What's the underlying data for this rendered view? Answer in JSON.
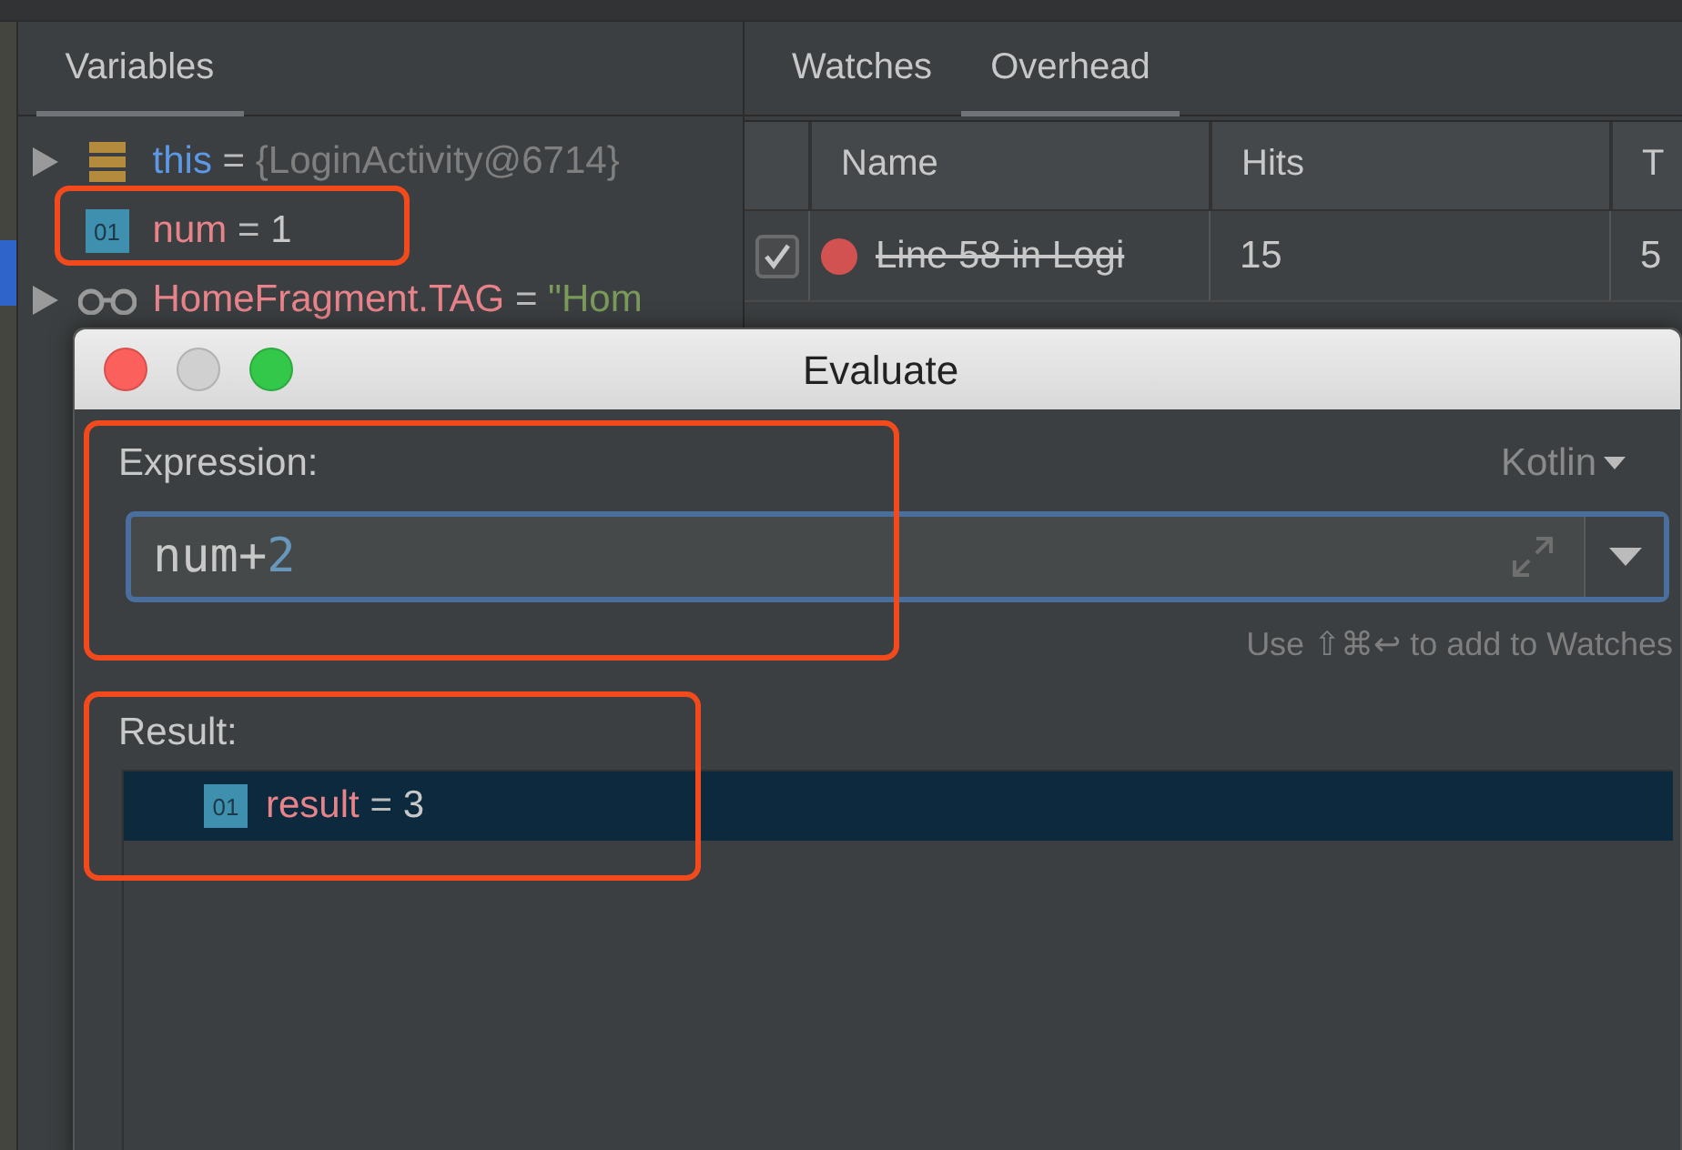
{
  "variables_panel": {
    "tab": {
      "label": "Variables",
      "selected": true
    },
    "items": [
      {
        "kind": "object",
        "expandable": true,
        "name": "this",
        "separator": "=",
        "value": "{LoginActivity@6714}"
      },
      {
        "kind": "primitive",
        "expandable": false,
        "icon_text": "01",
        "name": "num",
        "separator": "=",
        "value": "1"
      },
      {
        "kind": "static",
        "expandable": true,
        "name": "HomeFragment.TAG",
        "separator": "=",
        "value": "\"Hom"
      }
    ]
  },
  "right_panel": {
    "tabs": [
      {
        "label": "Watches",
        "selected": false
      },
      {
        "label": "Overhead",
        "selected": true
      }
    ],
    "table": {
      "columns": [
        "Name",
        "Hits",
        "T"
      ],
      "rows": [
        {
          "checked": true,
          "muted": true,
          "color": "#d25252",
          "cells": [
            "Line 58 in Logi",
            "15",
            "5"
          ]
        }
      ]
    }
  },
  "dialog": {
    "title": "Evaluate",
    "expression_label": "Expression:",
    "language": "Kotlin",
    "expression": [
      {
        "kind": "identifier",
        "text": "num+"
      },
      {
        "kind": "number",
        "text": "2"
      }
    ],
    "hint": "Use ⇧⌘↩ to add to Watches",
    "result_label": "Result:",
    "results": [
      {
        "icon_text": "01",
        "name": "result",
        "separator": "=",
        "value": "3",
        "selected": true
      }
    ]
  }
}
